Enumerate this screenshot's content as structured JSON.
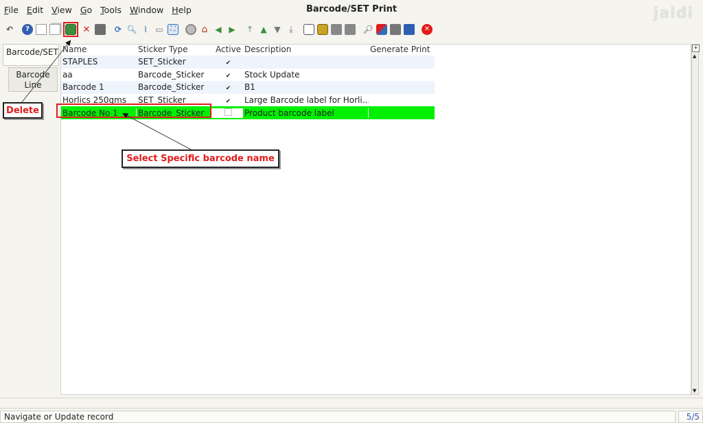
{
  "window": {
    "title": "Barcode/SET Print",
    "logo_text": "jaldi"
  },
  "menu": [
    "File",
    "Edit",
    "View",
    "Go",
    "Tools",
    "Window",
    "Help"
  ],
  "toolbar": {
    "icons": [
      "undo-icon",
      "help-icon",
      "new-icon",
      "copy-icon",
      "delete-icon",
      "delete-selection-icon",
      "save-icon",
      "refresh-icon",
      "find-icon",
      "attachment-icon",
      "chat-icon",
      "grid-toggle-icon",
      "history-icon",
      "home-icon",
      "parent-record-icon",
      "detail-record-icon",
      "first-record-icon",
      "previous-record-icon",
      "next-record-icon",
      "last-record-icon",
      "report-icon",
      "archive-icon",
      "print-preview-icon",
      "print-icon",
      "zoom-across-icon",
      "workflow-icon",
      "request-icon",
      "product-info-icon",
      "end-icon"
    ]
  },
  "left_panel": {
    "tab_main": "Barcode/SET",
    "tab_line": "Barcode\nLine"
  },
  "grid": {
    "columns": [
      "Name",
      "Sticker Type",
      "Active",
      "Description",
      "Generate Print"
    ],
    "rows": [
      {
        "name": "STAPLES",
        "sticker_type": "SET_Sticker",
        "active": true,
        "description": "",
        "generate_print": ""
      },
      {
        "name": "aa",
        "sticker_type": "Barcode_Sticker",
        "active": true,
        "description": "Stock Update",
        "generate_print": ""
      },
      {
        "name": "Barcode 1",
        "sticker_type": "Barcode_Sticker",
        "active": true,
        "description": "B1",
        "generate_print": ""
      },
      {
        "name": "Horlics 250gms",
        "sticker_type": "SET_Sticker",
        "active": true,
        "description": "Large Barcode label for Horli...",
        "generate_print": ""
      },
      {
        "name": "Barcode No 1",
        "sticker_type": "Barcode_Sticker",
        "active": false,
        "description": "Product barcode label",
        "generate_print": ""
      }
    ],
    "selected_row": 4
  },
  "annotations": {
    "delete_label": "Delete",
    "select_label": "Select Specific barcode name"
  },
  "status": {
    "text": "Navigate or Update record",
    "count": "5/5"
  },
  "colors": {
    "selected_row": "#00f000",
    "callout": "#e21b1b",
    "alt_row": "#eef4fb"
  }
}
